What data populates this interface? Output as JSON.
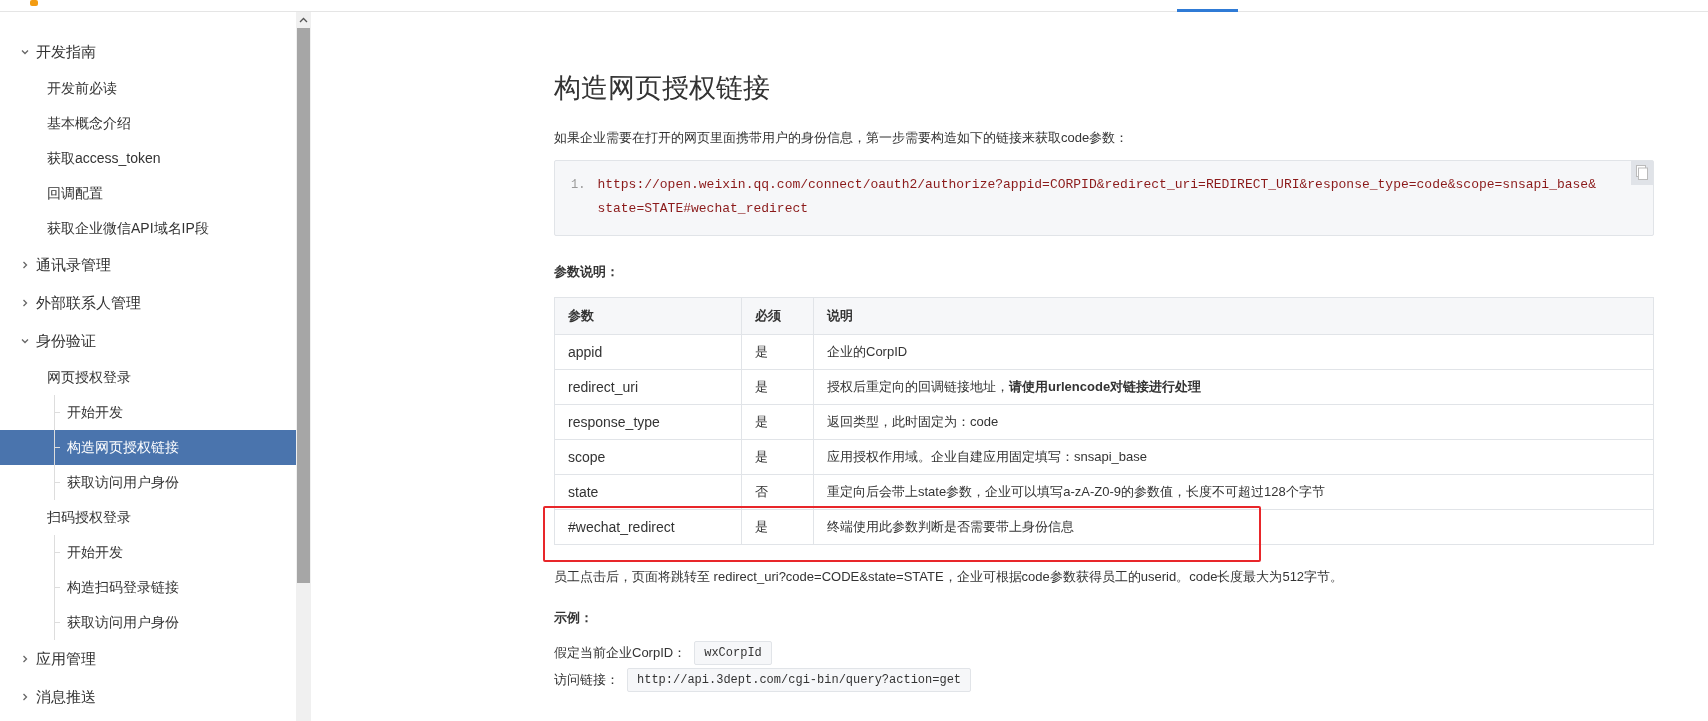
{
  "sidebar": {
    "items": [
      {
        "label": "开发指南",
        "expanded": true,
        "selected": false,
        "children": [
          {
            "label": "开发前必读",
            "selected": false
          },
          {
            "label": "基本概念介绍",
            "selected": false
          },
          {
            "label": "获取access_token",
            "selected": false
          },
          {
            "label": "回调配置",
            "selected": false
          },
          {
            "label": "获取企业微信API域名IP段",
            "selected": false
          }
        ]
      },
      {
        "label": "通讯录管理",
        "expanded": false,
        "selected": false
      },
      {
        "label": "外部联系人管理",
        "expanded": false,
        "selected": false
      },
      {
        "label": "身份验证",
        "expanded": true,
        "selected": false,
        "children": [
          {
            "label": "网页授权登录",
            "selected": false,
            "children": [
              {
                "label": "开始开发",
                "selected": false
              },
              {
                "label": "构造网页授权链接",
                "selected": true
              },
              {
                "label": "获取访问用户身份",
                "selected": false
              }
            ]
          },
          {
            "label": "扫码授权登录",
            "selected": false,
            "children": [
              {
                "label": "开始开发",
                "selected": false
              },
              {
                "label": "构造扫码登录链接",
                "selected": false
              },
              {
                "label": "获取访问用户身份",
                "selected": false
              }
            ]
          }
        ]
      },
      {
        "label": "应用管理",
        "expanded": false,
        "selected": false
      },
      {
        "label": "消息推送",
        "expanded": false,
        "selected": false
      }
    ]
  },
  "article": {
    "title": "构造网页授权链接",
    "intro": "如果企业需要在打开的网页里面携带用户的身份信息，第一步需要构造如下的链接来获取code参数：",
    "code": {
      "line_number": "1.",
      "text": "https://open.weixin.qq.com/connect/oauth2/authorize?appid=CORPID&redirect_uri=REDIRECT_URI&response_type=code&scope=snsapi_base&state=STATE#wechat_redirect"
    },
    "params_heading": "参数说明：",
    "table": {
      "columns": [
        "参数",
        "必须",
        "说明"
      ],
      "rows": [
        {
          "cells": [
            "appid",
            "是",
            "企业的CorpID"
          ],
          "highlighted": false
        },
        {
          "cells": [
            "redirect_uri",
            "是",
            "授权后重定向的回调链接地址，**请使用urlencode对链接进行处理**"
          ],
          "highlighted": false
        },
        {
          "cells": [
            "response_type",
            "是",
            "返回类型，此时固定为：code"
          ],
          "highlighted": false
        },
        {
          "cells": [
            "scope",
            "是",
            "应用授权作用域。企业自建应用固定填写：snsapi_base"
          ],
          "highlighted": false
        },
        {
          "cells": [
            "state",
            "否",
            "重定向后会带上state参数，企业可以填写a-zA-Z0-9的参数值，长度不可超过128个字节"
          ],
          "highlighted": false
        },
        {
          "cells": [
            "#wechat_redirect",
            "是",
            "终端使用此参数判断是否需要带上身份信息"
          ],
          "highlighted": true
        }
      ]
    },
    "after_text": "员工点击后，页面将跳转至 redirect_uri?code=CODE&state=STATE，企业可根据code参数获得员工的userid。code长度最大为512字节。",
    "example_heading": "示例：",
    "examples": [
      {
        "label": "假定当前企业CorpID：",
        "value": "wxCorpId"
      },
      {
        "label": "访问链接：",
        "value": "http://api.3dept.com/cgi-bin/query?action=get"
      }
    ]
  }
}
